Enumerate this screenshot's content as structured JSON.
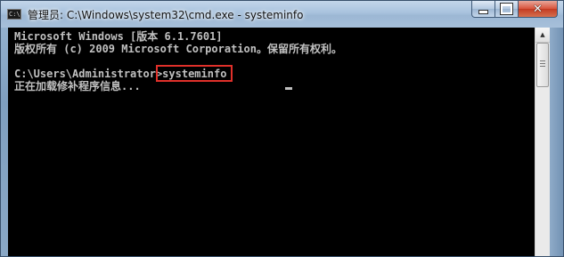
{
  "window": {
    "title": "管理员: C:\\Windows\\system32\\cmd.exe - systeminfo",
    "icon": "cmd-icon",
    "icon_text": "C:\\"
  },
  "controls": {
    "minimize_icon": "minimize-icon",
    "maximize_icon": "maximize-icon",
    "close_icon": "close-icon",
    "close_glyph": "✕",
    "close_color": "#c33b22"
  },
  "console": {
    "background": "#000000",
    "text_color": "#c0c0c0",
    "lines": [
      "Microsoft Windows [版本 6.1.7601]",
      "版权所有 (c) 2009 Microsoft Corporation。保留所有权利。",
      "",
      "C:\\Users\\Administrator>systeminfo",
      "正在加载修补程序信息..."
    ],
    "highlight_color": "#e0302a"
  },
  "scrollbar": {
    "up_arrow": "▲"
  }
}
